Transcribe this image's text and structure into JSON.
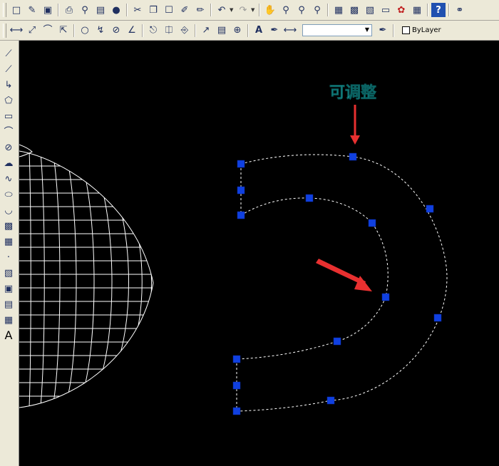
{
  "toolbar_top": {
    "tools": [
      "new-icon",
      "open-icon",
      "save-icon",
      "print-icon",
      "plot-preview-icon",
      "publish-icon",
      "etransmit-icon",
      "cut-icon",
      "copy-icon",
      "paste-icon",
      "match-properties-icon",
      "block-editor-icon",
      "undo-icon",
      "redo-icon",
      "pan-icon",
      "zoom-realtime-icon",
      "zoom-window-icon",
      "zoom-previous-icon",
      "properties-icon",
      "design-center-icon",
      "tool-palettes-icon",
      "sheet-set-icon",
      "markup-icon",
      "calculator-icon",
      "help-icon",
      "3d-orbit-icon"
    ]
  },
  "toolbar_dim": {
    "tools": [
      "linear-dim-icon",
      "aligned-dim-icon",
      "arc-length-icon",
      "ordinate-icon",
      "radius-icon",
      "jogged-icon",
      "diameter-icon",
      "angular-icon",
      "quick-dim-icon",
      "baseline-icon",
      "continue-icon",
      "leader-icon",
      "tolerance-icon",
      "center-mark-icon",
      "dimedit-icon",
      "dimtedit-icon",
      "dim-update-icon"
    ],
    "dimstyle_value": "",
    "layer_label": "ByLayer"
  },
  "draw_tools": [
    "line-icon",
    "construction-line-icon",
    "polyline-icon",
    "polygon-icon",
    "rectangle-icon",
    "arc-icon",
    "circle-icon",
    "revcloud-icon",
    "spline-icon",
    "ellipse-icon",
    "ellipse-arc-icon",
    "insert-block-icon",
    "make-block-icon",
    "point-icon",
    "hatch-icon",
    "gradient-icon",
    "region-icon",
    "table-icon",
    "mtext-icon"
  ],
  "mtext_glyph": "A",
  "annotation": {
    "text": "可调整",
    "color": "#33e0e0",
    "arrow_color": "#e83030"
  },
  "grip_color": "#1040e0",
  "wire_color": "#ffffff"
}
